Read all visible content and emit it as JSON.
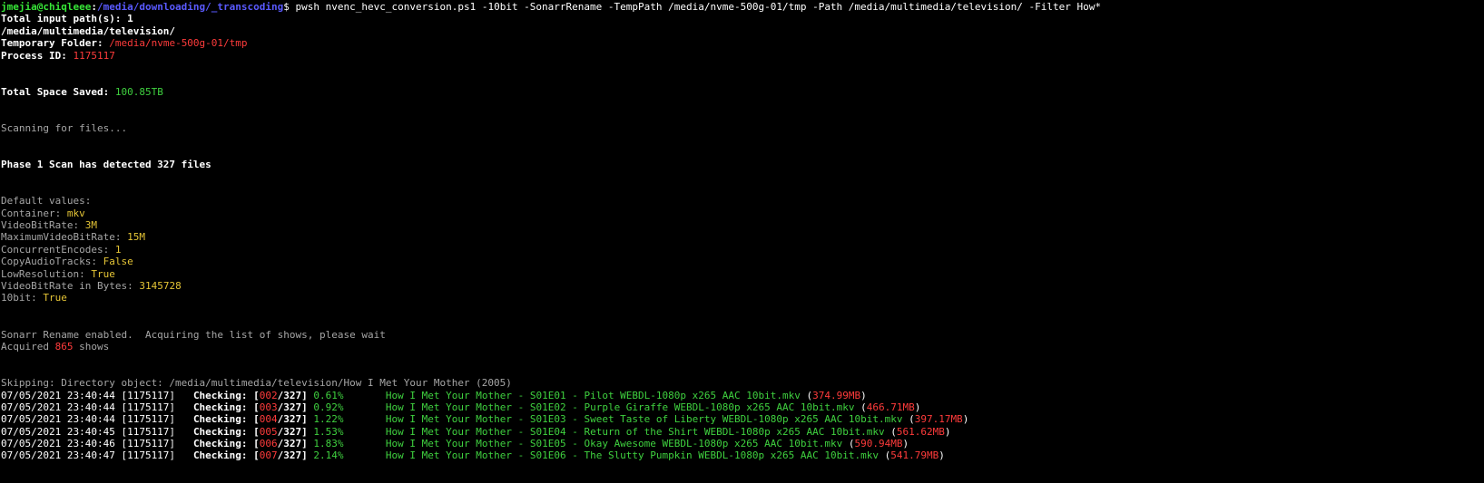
{
  "prompt": {
    "user_host": "jmejia@chiqleee",
    "separator": ":",
    "cwd": "/media/downloading/_transcoding",
    "symbol": "$",
    "command": " pwsh nvenc_hevc_conversion.ps1 -10bit -SonarrRename -TempPath /media/nvme-500g-01/tmp -Path /media/multimedia/television/ -Filter How*"
  },
  "header": {
    "input_paths_label": "Total input path(s): 1",
    "input_path": "/media/multimedia/television/",
    "temp_label": "Temporary Folder: ",
    "temp_value": "/media/nvme-500g-01/tmp",
    "pid_label": "Process ID: ",
    "pid_value": "1175117"
  },
  "space": {
    "label": "Total Space Saved: ",
    "value": "100.85TB"
  },
  "scanning": "Scanning for files...",
  "phase": "Phase 1 Scan has detected 327 files",
  "defaults": {
    "title": "Default values:",
    "items": [
      {
        "label": "Container: ",
        "value": "mkv"
      },
      {
        "label": "VideoBitRate: ",
        "value": "3M"
      },
      {
        "label": "MaximumVideoBitRate: ",
        "value": "15M"
      },
      {
        "label": "ConcurrentEncodes: ",
        "value": "1"
      },
      {
        "label": "CopyAudioTracks: ",
        "value": "False"
      },
      {
        "label": "LowResolution: ",
        "value": "True"
      },
      {
        "label": "VideoBitRate in Bytes: ",
        "value": "3145728"
      },
      {
        "label": "10bit: ",
        "value": "True"
      }
    ]
  },
  "sonarr": {
    "message": "Sonarr Rename enabled.  Acquiring the list of shows, please wait",
    "acquired_label": "Acquired ",
    "acquired_count": "865",
    "acquired_suffix": " shows"
  },
  "skipping": "Skipping: Directory object: /media/multimedia/television/How I Met Your Mother (2005)",
  "log_rows": [
    {
      "timestamp": "07/05/2021 23:40:44 [1175117]",
      "label": "Checking:",
      "index": "002",
      "total": "327",
      "percent": "0.61%",
      "file": "How I Met Your Mother - S01E01 - Pilot WEBDL-1080p x265 AAC 10bit.mkv",
      "size": "374.99MB"
    },
    {
      "timestamp": "07/05/2021 23:40:44 [1175117]",
      "label": "Checking:",
      "index": "003",
      "total": "327",
      "percent": "0.92%",
      "file": "How I Met Your Mother - S01E02 - Purple Giraffe WEBDL-1080p x265 AAC 10bit.mkv",
      "size": "466.71MB"
    },
    {
      "timestamp": "07/05/2021 23:40:44 [1175117]",
      "label": "Checking:",
      "index": "004",
      "total": "327",
      "percent": "1.22%",
      "file": "How I Met Your Mother - S01E03 - Sweet Taste of Liberty WEBDL-1080p x265 AAC 10bit.mkv",
      "size": "397.17MB"
    },
    {
      "timestamp": "07/05/2021 23:40:45 [1175117]",
      "label": "Checking:",
      "index": "005",
      "total": "327",
      "percent": "1.53%",
      "file": "How I Met Your Mother - S01E04 - Return of the Shirt WEBDL-1080p x265 AAC 10bit.mkv",
      "size": "561.62MB"
    },
    {
      "timestamp": "07/05/2021 23:40:46 [1175117]",
      "label": "Checking:",
      "index": "006",
      "total": "327",
      "percent": "1.83%",
      "file": "How I Met Your Mother - S01E05 - Okay Awesome WEBDL-1080p x265 AAC 10bit.mkv",
      "size": "590.94MB"
    },
    {
      "timestamp": "07/05/2021 23:40:47 [1175117]",
      "label": "Checking:",
      "index": "007",
      "total": "327",
      "percent": "2.14%",
      "file": "How I Met Your Mother - S01E06 - The Slutty Pumpkin WEBDL-1080p x265 AAC 10bit.mkv",
      "size": "541.79MB"
    }
  ],
  "colors": {
    "background": "#000000",
    "user": "#37e637",
    "path": "#5a5aff",
    "red": "#ff3b3b",
    "yellow": "#e5c536",
    "green": "#3fd13f",
    "grey": "#a6a6a6"
  }
}
